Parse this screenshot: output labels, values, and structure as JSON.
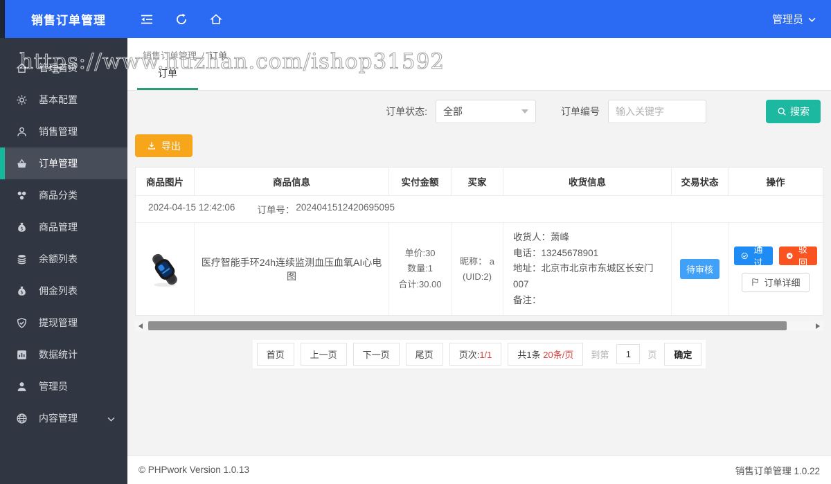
{
  "header": {
    "title": "销售订单管理",
    "user_label": "管理员"
  },
  "watermark": "https://www.huzhan.com/ishop31592",
  "sidebar": {
    "items": [
      {
        "label": "管理首页"
      },
      {
        "label": "基本配置"
      },
      {
        "label": "销售管理"
      },
      {
        "label": "订单管理"
      },
      {
        "label": "商品分类"
      },
      {
        "label": "商品管理"
      },
      {
        "label": "余额列表"
      },
      {
        "label": "佣金列表"
      },
      {
        "label": "提现管理"
      },
      {
        "label": "数据统计"
      },
      {
        "label": "管理员"
      },
      {
        "label": "内容管理"
      }
    ]
  },
  "breadcrumb": {
    "parent": "销售订单管理",
    "separator": "/",
    "current": "订单"
  },
  "tab": {
    "label": "订单"
  },
  "filters": {
    "status_label": "订单状态:",
    "status_value": "全部",
    "order_no_label": "订单编号",
    "keyword_placeholder": "输入关键字",
    "search_label": "搜索"
  },
  "toolbar": {
    "export_label": "导出"
  },
  "table": {
    "headers": [
      "商品图片",
      "商品信息",
      "实付金额",
      "买家",
      "收货信息",
      "交易状态",
      "操作"
    ],
    "order": {
      "datetime": "2024-04-15 12:42:06",
      "order_no_label": "订单号：",
      "order_no": "2024041512420695095",
      "product_title": "医疗智能手环24h连续监测血压血氧AI心电图",
      "price_line1": "单价:30",
      "price_line2": "数量:1",
      "price_line3": "合计:30.00",
      "buyer_line1": "昵称： a",
      "buyer_line2": "(UID:2)",
      "ship_line1": "收货人：萧峰",
      "ship_line2": "电话：13245678901",
      "ship_line3": "地址：北京市北京市东城区长安门007",
      "ship_line4": "备注：",
      "status": "待审核",
      "approve_label": "通过",
      "reject_label": "驳回",
      "detail_label": "订单详细"
    }
  },
  "pagination": {
    "first": "首页",
    "prev": "上一页",
    "next": "下一页",
    "last": "尾页",
    "page_info_label": "页次:",
    "page_info_value": "1/1",
    "total_label": "共1条",
    "per_page": "20条/页",
    "goto_label": "到第",
    "goto_value": "1",
    "goto_suffix": "页",
    "confirm": "确定"
  },
  "footer": {
    "left": "© PHPwork Version 1.0.13",
    "right": "销售订单管理 1.0.22"
  },
  "colors": {
    "topbar_blue": "#2b6af3",
    "sidebar_dark": "#313742",
    "active_accent_teal": "#15b89a",
    "tab_underline_green": "#2c9c72",
    "search_teal": "#1cb9a0",
    "export_orange": "#f7a51b",
    "approve_blue": "#1f8cf5",
    "reject_orange": "#f95321",
    "status_badge_blue": "#41a0f8",
    "pagination_red": "#d9403d"
  }
}
